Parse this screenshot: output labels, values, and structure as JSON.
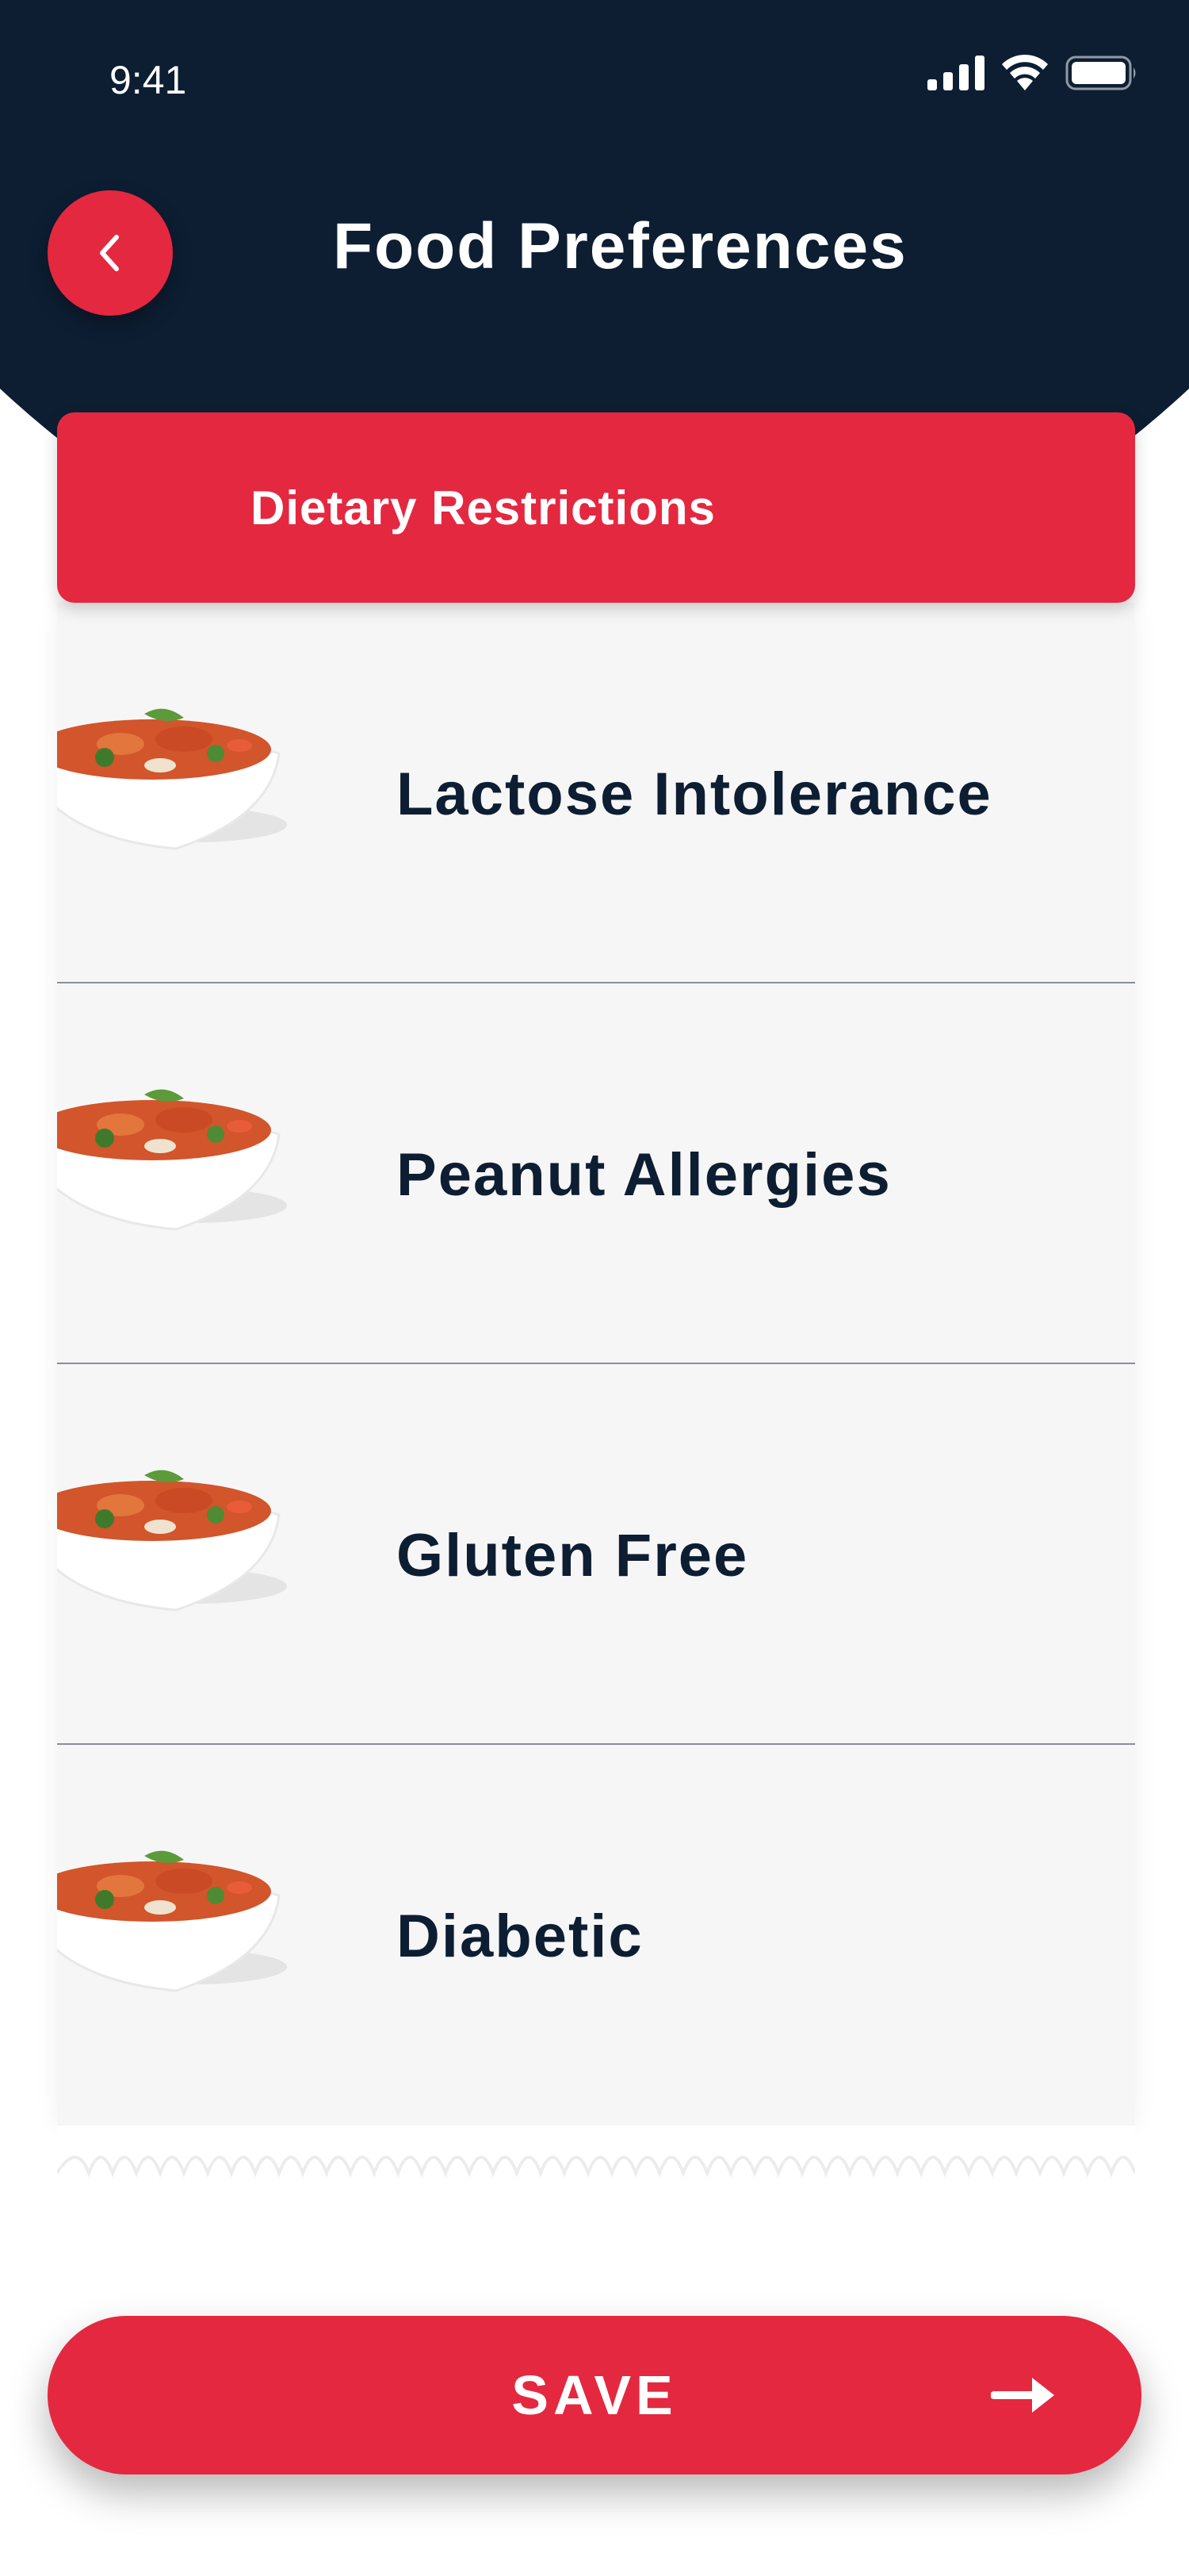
{
  "status_bar": {
    "time": "9:41",
    "icons": [
      "signal-icon",
      "wifi-icon",
      "battery-icon"
    ]
  },
  "header": {
    "back_icon": "chevron-left-icon",
    "title": "Food Preferences"
  },
  "card": {
    "title": "Dietary Restrictions",
    "items": [
      {
        "label": "Lactose Intolerance",
        "image": "pasta-bowl-image"
      },
      {
        "label": "Peanut Allergies",
        "image": "pasta-bowl-image"
      },
      {
        "label": "Gluten Free",
        "image": "pasta-bowl-image"
      },
      {
        "label": "Diabetic",
        "image": "pasta-bowl-image"
      }
    ]
  },
  "save_button": {
    "label": "SAVE",
    "icon": "arrow-right-icon"
  },
  "colors": {
    "header_background": "#0d1e33",
    "accent": "#e42840",
    "list_background": "#f6f6f6",
    "text_dark": "#0d1e33"
  }
}
